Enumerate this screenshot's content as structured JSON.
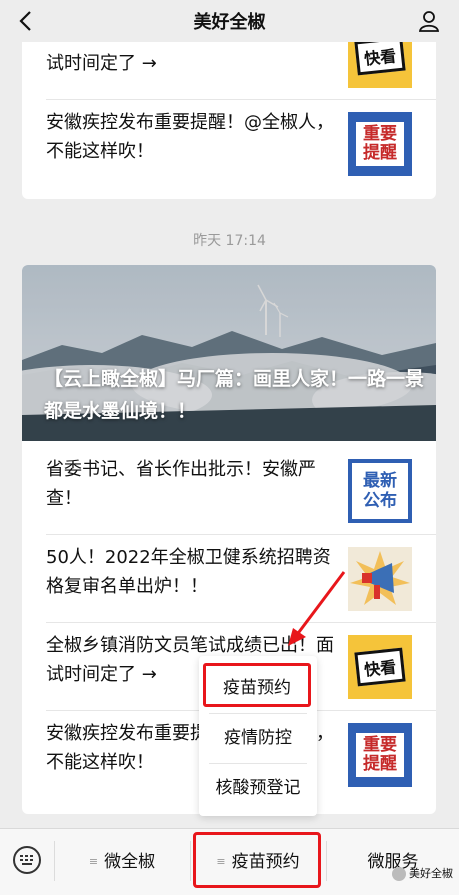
{
  "header": {
    "title": "美好全椒"
  },
  "card_top": {
    "items": [
      {
        "text": "全椒乡镇消防文员笔试成绩已出！面试时间定了 →",
        "thumb_label": "快看"
      },
      {
        "text": "安徽疾控发布重要提醒！@全椒人，不能这样吹！",
        "thumb_label": "重要提醒"
      }
    ]
  },
  "timestamp": "昨天 17:14",
  "card_main": {
    "hero_caption": "【云上瞰全椒】马厂篇：画里人家！一路一景都是水墨仙境！！",
    "items": [
      {
        "text": "省委书记、省长作出批示！安徽严查！",
        "thumb_label": "最新公布"
      },
      {
        "text": "50人！2022年全椒卫健系统招聘资格复审名单出炉！！",
        "thumb_label": ""
      },
      {
        "text": "全椒乡镇消防文员笔试成绩已出！面试时间定了 →",
        "thumb_label": "快看"
      },
      {
        "text": "安徽疾控发布重要提醒！@全椒人，不能这样吹！",
        "thumb_label": "重要提醒"
      }
    ]
  },
  "popup_menu": {
    "items": [
      "疫苗预约",
      "疫情防控",
      "核酸预登记"
    ]
  },
  "bottom_menu": {
    "items": [
      "微全椒",
      "疫苗预约",
      "微服务"
    ]
  },
  "watermark": "美好全椒",
  "colors": {
    "highlight": "#e8161b",
    "badge_blue": "#2f5fb3",
    "badge_yellow": "#f5c43a"
  }
}
